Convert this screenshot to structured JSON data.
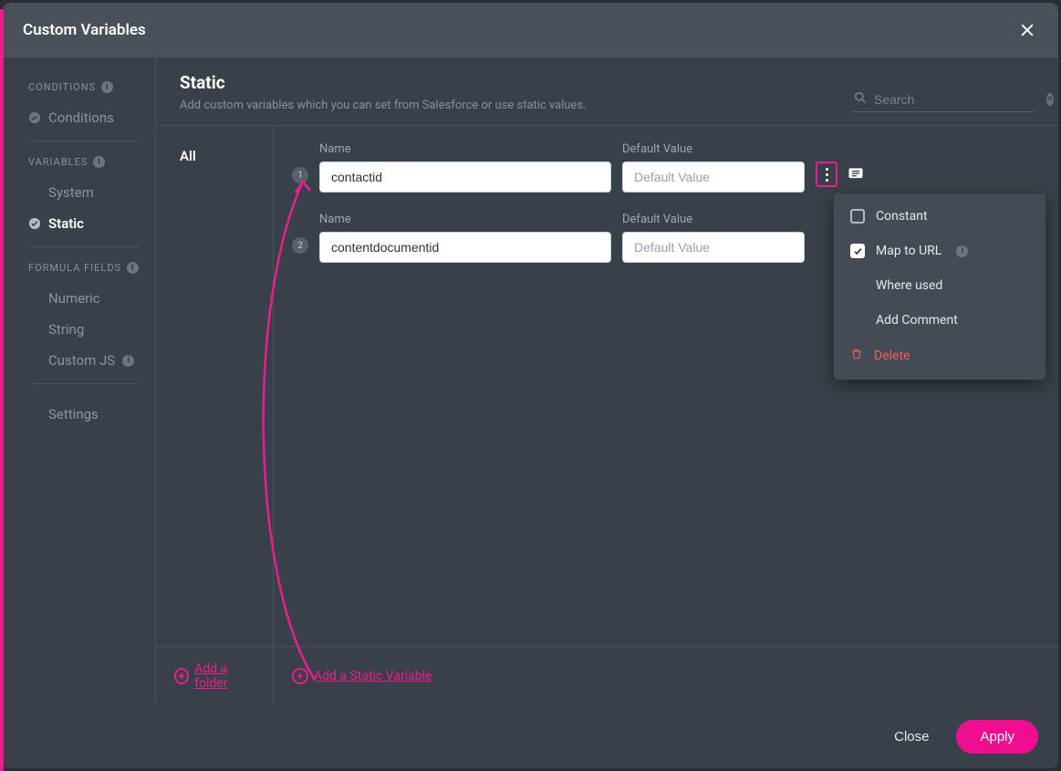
{
  "header": {
    "title": "Custom Variables"
  },
  "sidebar": {
    "sections": [
      {
        "title": "CONDITIONS",
        "has_info": true,
        "items": [
          {
            "label": "Conditions",
            "checked": true,
            "active": false
          }
        ]
      },
      {
        "title": "VARIABLES",
        "has_info": true,
        "items": [
          {
            "label": "System",
            "checked": false,
            "active": false
          },
          {
            "label": "Static",
            "checked": true,
            "active": true
          }
        ]
      },
      {
        "title": "FORMULA FIELDS",
        "has_info": true,
        "items": [
          {
            "label": "Numeric",
            "checked": false,
            "active": false
          },
          {
            "label": "String",
            "checked": false,
            "active": false
          },
          {
            "label": "Custom JS",
            "checked": false,
            "active": false,
            "has_info": true
          }
        ],
        "trailing": [
          {
            "label": "Settings"
          }
        ]
      }
    ]
  },
  "main": {
    "title": "Static",
    "subtitle": "Add custom variables which you can set from Salesforce or use static values.",
    "search_placeholder": "Search",
    "folder_all": "All",
    "name_label": "Name",
    "value_label": "Default Value",
    "value_placeholder": "Default Value",
    "variables": [
      {
        "num": "1",
        "name": "contactid",
        "value": ""
      },
      {
        "num": "2",
        "name": "contentdocumentid",
        "value": ""
      }
    ],
    "add_folder_label": "Add a folder",
    "add_variable_label": "Add a Static Variable"
  },
  "context_menu": {
    "constant": "Constant",
    "map_to_url": "Map to URL",
    "where_used": "Where used",
    "add_comment": "Add Comment",
    "delete": "Delete"
  },
  "footer": {
    "close": "Close",
    "apply": "Apply"
  },
  "colors": {
    "accent_pink": "#e91e8c",
    "danger": "#ef5d5d"
  }
}
